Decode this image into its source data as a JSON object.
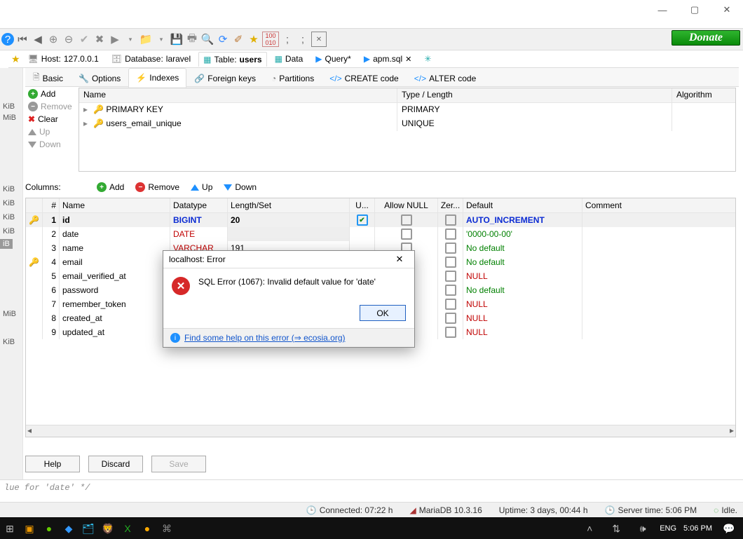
{
  "window": {
    "controls": {
      "min": "—",
      "max": "▢",
      "close": "✕"
    }
  },
  "donate": "Donate",
  "toolbar_icons": [
    "help-icon",
    "nav-first-icon",
    "nav-prev-icon",
    "add-icon",
    "remove-icon",
    "accept-icon",
    "cancel-icon",
    "run-icon",
    "chevron-down-icon",
    "open-folder-icon",
    "chevron-down-icon",
    "save-icon",
    "print-icon",
    "find-icon",
    "refresh-icon",
    "brush-icon",
    "bookmark-icon",
    "hex-icon",
    "semicolon-icon",
    "semicolon-icon",
    "close-tab-icon"
  ],
  "addr": {
    "star": "★",
    "host_label": "Host:",
    "host_value": "127.0.0.1",
    "db_label": "Database:",
    "db_value": "laravel",
    "table_label": "Table:",
    "table_value": "users",
    "tabs": [
      {
        "label": "Data"
      },
      {
        "label": "Query*"
      },
      {
        "label": "apm.sql"
      }
    ]
  },
  "subtabs": {
    "basic": "Basic",
    "options": "Options",
    "indexes": "Indexes",
    "foreign": "Foreign keys",
    "partitions": "Partitions",
    "create": "CREATE code",
    "alter": "ALTER code"
  },
  "sidebar_units": [
    "KiB",
    "MiB",
    "KiB",
    "KiB",
    "KiB",
    "KiB",
    "MiB",
    "KiB"
  ],
  "sidebar_sel": "iB",
  "idx_actions": {
    "add": "Add",
    "remove": "Remove",
    "clear": "Clear",
    "up": "Up",
    "down": "Down"
  },
  "idx_headers": {
    "name": "Name",
    "type": "Type / Length",
    "algo": "Algorithm"
  },
  "idx_rows": [
    {
      "name": "PRIMARY KEY",
      "type": "PRIMARY"
    },
    {
      "name": "users_email_unique",
      "type": "UNIQUE"
    }
  ],
  "idx_expander": "▸",
  "columns_label": "Columns:",
  "col_actions": {
    "add": "Add",
    "remove": "Remove",
    "up": "Up",
    "down": "Down"
  },
  "col_headers": {
    "num": "#",
    "name": "Name",
    "dtype": "Datatype",
    "len": "Length/Set",
    "u": "U...",
    "null": "Allow NULL",
    "zer": "Zer...",
    "def": "Default",
    "comm": "Comment"
  },
  "columns": [
    {
      "n": "1",
      "key": "y",
      "name": "id",
      "dtype": "BIGINT",
      "dclass": "dtype-blue",
      "len": "20",
      "u": true,
      "null": false,
      "zer": false,
      "def": "AUTO_INCREMENT",
      "defClass": "def-blue"
    },
    {
      "n": "2",
      "name": "date",
      "dtype": "DATE",
      "dclass": "dtype-red",
      "len": "",
      "u": null,
      "null": false,
      "zer": null,
      "def": "'0000-00-00'",
      "defClass": "def-green"
    },
    {
      "n": "3",
      "name": "name",
      "dtype": "VARCHAR",
      "dclass": "dtype-red",
      "len": "191",
      "u": null,
      "null": false,
      "zer": null,
      "def": "No default",
      "defClass": "def-green"
    },
    {
      "n": "4",
      "key": "r",
      "name": "email",
      "dtype": "",
      "dclass": "",
      "len": "",
      "u": null,
      "null": null,
      "zer": null,
      "def": "No default",
      "defClass": "def-green"
    },
    {
      "n": "5",
      "name": "email_verified_at",
      "dtype": "",
      "dclass": "",
      "len": "",
      "u": null,
      "null": null,
      "zer": null,
      "def": "NULL",
      "defClass": "def-red"
    },
    {
      "n": "6",
      "name": "password",
      "dtype": "",
      "dclass": "",
      "len": "",
      "u": null,
      "null": null,
      "zer": null,
      "def": "No default",
      "defClass": "def-green"
    },
    {
      "n": "7",
      "name": "remember_token",
      "dtype": "",
      "dclass": "",
      "len": "",
      "u": null,
      "null": null,
      "zer": null,
      "def": "NULL",
      "defClass": "def-red"
    },
    {
      "n": "8",
      "name": "created_at",
      "dtype": "",
      "dclass": "",
      "len": "",
      "u": null,
      "null": null,
      "zer": null,
      "def": "NULL",
      "defClass": "def-red"
    },
    {
      "n": "9",
      "name": "updated_at",
      "dtype": "",
      "dclass": "",
      "len": "",
      "u": null,
      "null": null,
      "zer": null,
      "def": "NULL",
      "defClass": "def-red"
    }
  ],
  "bottom": {
    "help": "Help",
    "discard": "Discard",
    "save": "Save"
  },
  "sql_comment": "lue for 'date' */",
  "status": {
    "connected": "Connected: 07:22 h",
    "server": "MariaDB 10.3.16",
    "uptime": "Uptime: 3 days, 00:44 h",
    "servertime": "Server time: 5:06 PM",
    "idle": "Idle."
  },
  "taskbar": {
    "lang": "ENG",
    "clock": "5:06 PM"
  },
  "dialog": {
    "title": "localhost: Error",
    "message": "SQL Error (1067): Invalid default value for 'date'",
    "ok": "OK",
    "link": "Find some help on this error (⇒ ecosia.org)"
  }
}
